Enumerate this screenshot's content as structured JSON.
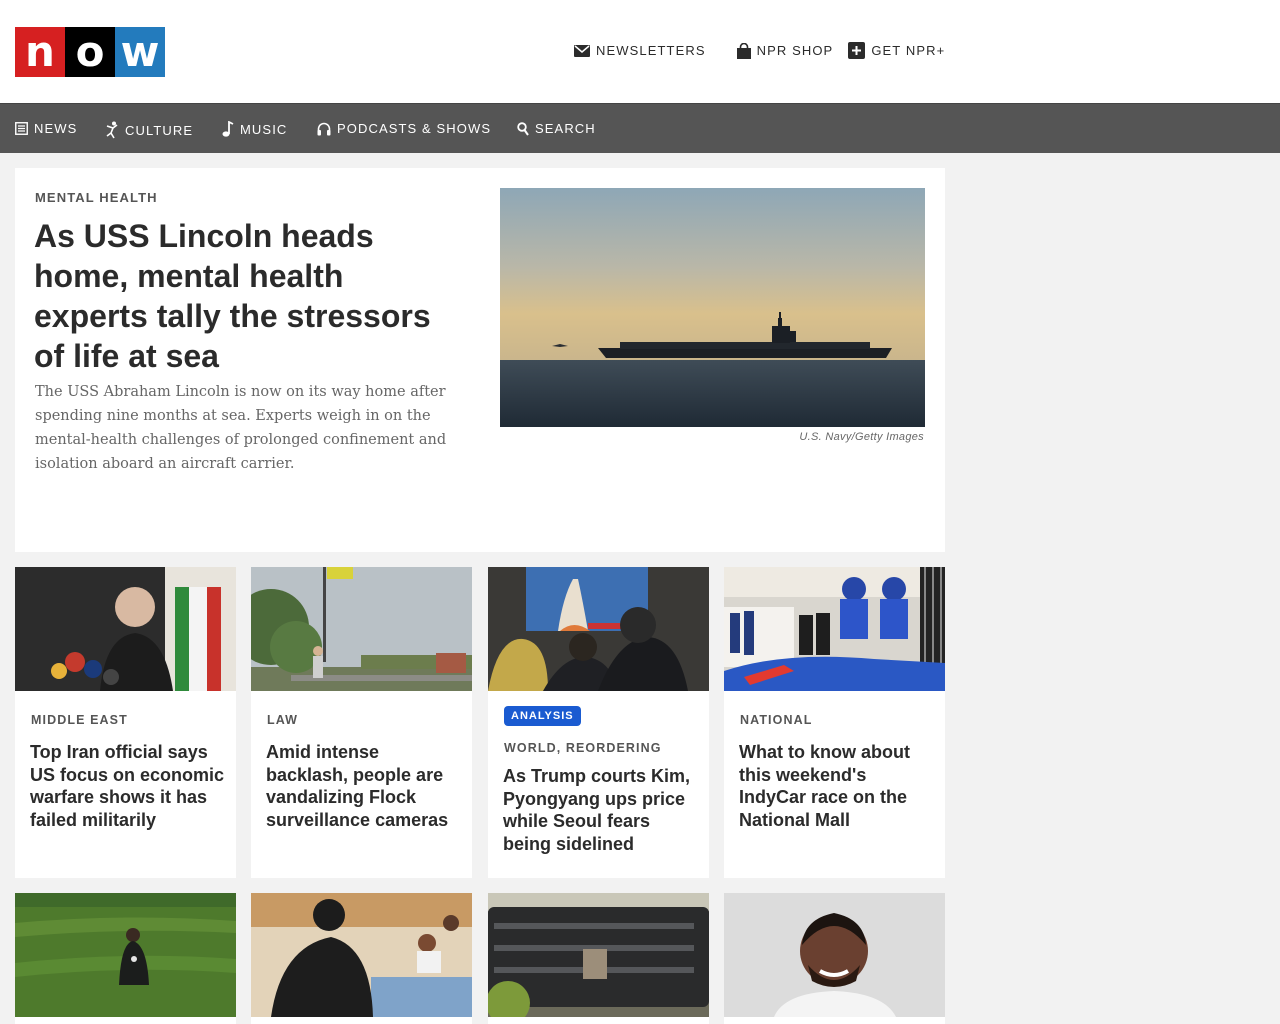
{
  "logo": {
    "letters": [
      "n",
      "o",
      "w"
    ]
  },
  "utilities": [
    {
      "label": "NEWSLETTERS",
      "icon": "envelope-icon"
    },
    {
      "label": "NPR SHOP",
      "icon": "shopping-bag-icon"
    },
    {
      "label": "GET NPR+",
      "icon": "plus-square-icon"
    }
  ],
  "nav": [
    {
      "label": "NEWS",
      "icon": "newspaper-icon"
    },
    {
      "label": "CULTURE",
      "icon": "dancer-icon"
    },
    {
      "label": "MUSIC",
      "icon": "music-note-icon"
    },
    {
      "label": "PODCASTS & SHOWS",
      "icon": "headphones-icon"
    },
    {
      "label": "SEARCH",
      "icon": "search-icon"
    }
  ],
  "featured": {
    "slug": "MENTAL HEALTH",
    "title": "As USS Lincoln heads home, mental health experts tally the stressors of life at sea",
    "teaser": "The USS Abraham Lincoln is now on its way home after spending nine months at sea. Experts weigh in on the mental-health challenges of prolonged confinement and isolation aboard an aircraft carrier.",
    "credit": "U.S. Navy/Getty Images"
  },
  "cards": [
    {
      "slug": "MIDDLE EAST",
      "title": "Top Iran official says US focus on economic warfare shows it has failed militarily"
    },
    {
      "slug": "LAW",
      "title": "Amid intense backlash, people are vandalizing Flock surveillance cameras"
    },
    {
      "badge": "ANALYSIS",
      "slug": "WORLD, REORDERING",
      "title": "As Trump courts Kim, Pyongyang ups price while Seoul fears being sidelined"
    },
    {
      "slug": "NATIONAL",
      "title": "What to know about this weekend's IndyCar race on the National Mall"
    }
  ],
  "colors": {
    "logo_red": "#d62021",
    "logo_black": "#000000",
    "logo_blue": "#237bbd",
    "nav_bg": "#555555",
    "badge_blue": "#1a5bd1"
  }
}
